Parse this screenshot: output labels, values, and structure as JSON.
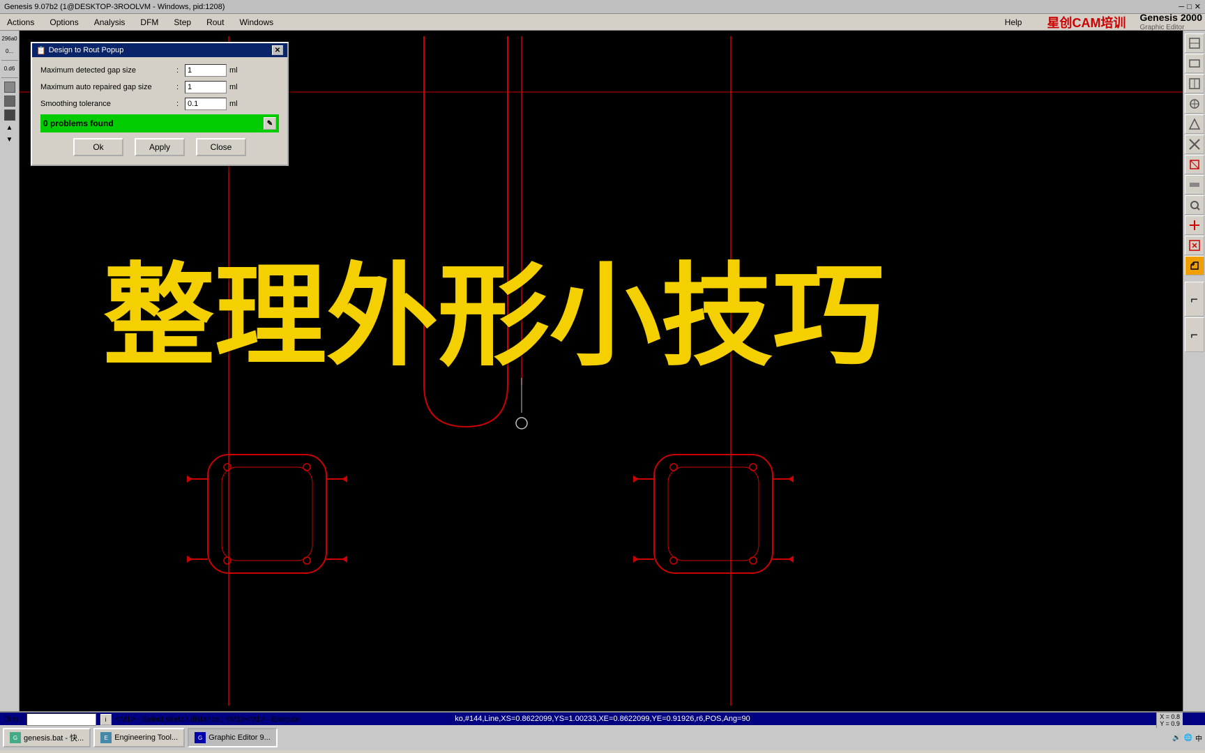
{
  "titlebar": {
    "text": "Genesis 9.07b2 (1@DESKTOP-3ROOLVM - Windows, pid:1208)"
  },
  "menubar": {
    "items": [
      "Actions",
      "Options",
      "Analysis",
      "DFM",
      "Step",
      "Rout",
      "Windows",
      "Help"
    ]
  },
  "brand": {
    "logo": "星创CAM培训",
    "title": "Genesis 2000",
    "subtitle": "Graphic Editor"
  },
  "dialog": {
    "title": "Design to Rout Popup",
    "fields": [
      {
        "label": "Maximum detected gap size",
        "value": "1",
        "unit": "ml"
      },
      {
        "label": "Maximum auto repaired gap size",
        "value": "1",
        "unit": "ml"
      },
      {
        "label": "Smoothing tolerance",
        "value": "0.1",
        "unit": "ml"
      }
    ],
    "status": "0 problems found",
    "buttons": [
      "Ok",
      "Apply",
      "Close"
    ]
  },
  "canvas": {
    "chinese_text": "整理外形小技巧"
  },
  "statusline": {
    "text": "ko,#144,Line,XS=0.8622099,YS=1.00233,XE=0.8622099,YE=0.91926,r6,POS,Ang=90"
  },
  "dim": {
    "label": "Dim :",
    "help": "<M1> - Select stretch distance ; <M1><M1> - Execute"
  },
  "taskbar": {
    "items": [
      "genesis.bat - 快...",
      "Engineering Tool...",
      "Graphic Editor 9..."
    ]
  },
  "coords": {
    "x": "X = 0.8",
    "y": "Y = 0.9"
  },
  "sidebar": {
    "items": [
      "296a0",
      "0...",
      "0.d6",
      "",
      "",
      "",
      "",
      "",
      "",
      "",
      "",
      ""
    ]
  }
}
